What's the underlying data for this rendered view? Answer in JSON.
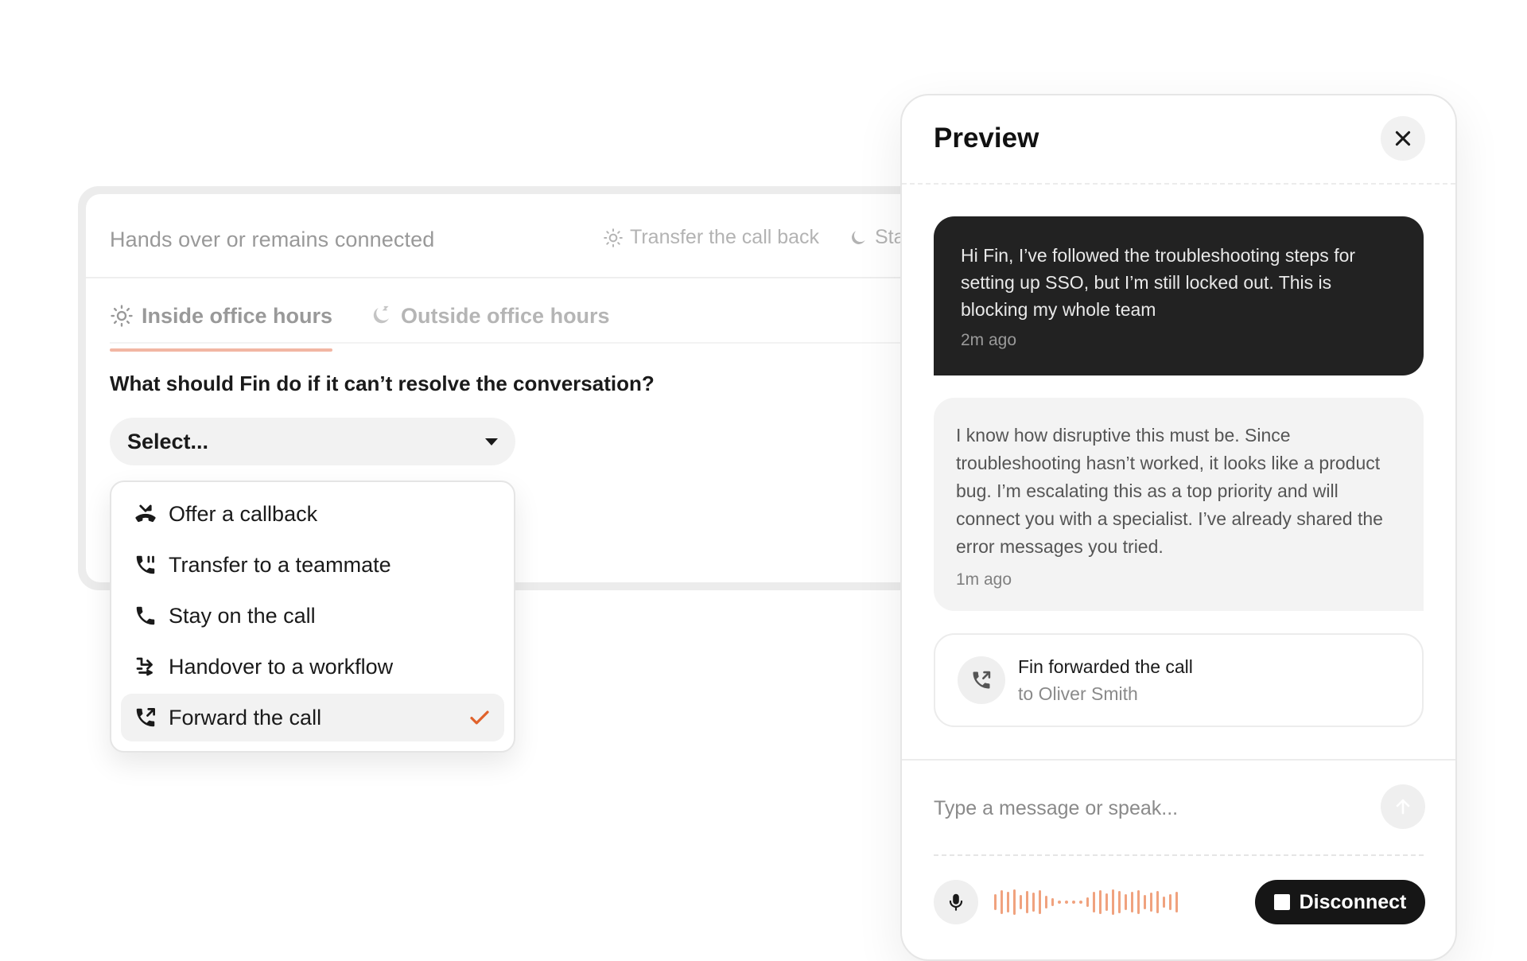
{
  "settings": {
    "header_title": "Hands over or remains connected",
    "header_chips": [
      {
        "label": "Transfer the call back",
        "icon": "sun-icon"
      },
      {
        "label": "Sta",
        "icon": "moon-icon"
      }
    ],
    "tabs": [
      {
        "label": "Inside office hours",
        "icon": "sun-icon",
        "active": true
      },
      {
        "label": "Outside office hours",
        "icon": "moon-icon",
        "active": false
      }
    ],
    "question": "What should Fin do if it can’t resolve the conversation?",
    "select_placeholder": "Select..."
  },
  "dropdown": {
    "items": [
      {
        "label": "Offer a callback",
        "icon": "callback-icon"
      },
      {
        "label": "Transfer to a teammate",
        "icon": "phone-transfer-icon"
      },
      {
        "label": "Stay on the call",
        "icon": "phone-icon"
      },
      {
        "label": "Handover to a workflow",
        "icon": "workflow-icon"
      },
      {
        "label": "Forward the call",
        "icon": "phone-forward-icon",
        "selected": true
      }
    ]
  },
  "preview": {
    "title": "Preview",
    "user_message": {
      "text": "Hi Fin, I’ve followed the troubleshooting steps for setting up SSO, but I’m still locked out. This is blocking my whole team",
      "time": "2m ago"
    },
    "fin_message": {
      "text": "I know how disruptive this must be. Since troubleshooting hasn’t worked, it looks like a product bug. I’m escalating this as a top priority and will connect you with a specialist. I’ve already shared the error messages you tried.",
      "time": "1m ago"
    },
    "event": {
      "title": "Fin forwarded the call",
      "subtitle": "to Oliver Smith"
    },
    "composer": {
      "placeholder": "Type a message or speak...",
      "disconnect_label": "Disconnect"
    }
  },
  "colors": {
    "accent_tab_underline": "#f2b6a3",
    "check": "#e0622b",
    "waveform": "#f0a27e",
    "dark_bubble": "#222222"
  }
}
